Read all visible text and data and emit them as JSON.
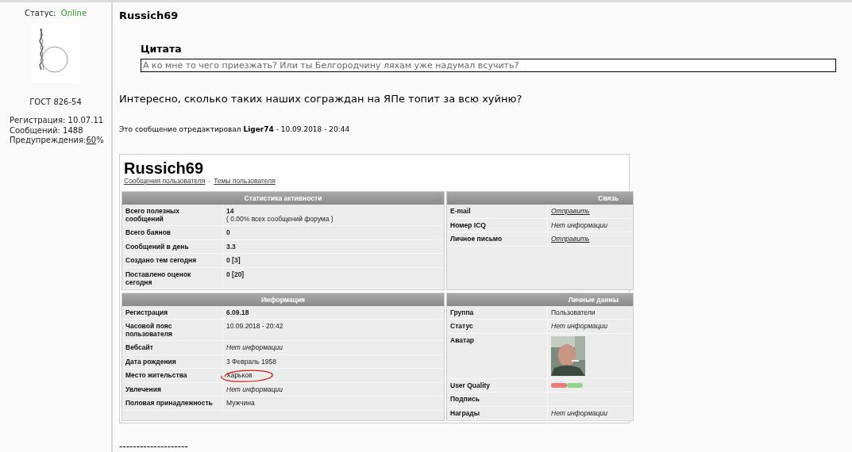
{
  "sidebar": {
    "status_label": "Статус:",
    "status_value": "Online",
    "online": true,
    "avatar_caption": "ГОСТ 826-54",
    "stats": [
      {
        "label": "Регистрация:",
        "value": "10.07.11"
      },
      {
        "label": "Сообщений:",
        "value": "1488"
      }
    ],
    "warnings": {
      "label": "Предупреждения:",
      "value": "60",
      "suffix": "%"
    }
  },
  "post": {
    "author": "Russich69",
    "quote": {
      "title": "Цитата",
      "text": "А ко мне то чего приезжать? Или ты Белгородчину ляхам уже надумал всучить?"
    },
    "body": "Интересно, сколько таких наших сограждан на ЯПе топит за всю хуйню?",
    "edit_note": "Это сообщение отредактировал **Liger74** - 10.09.2018 - 20:44",
    "signature": "--------------------"
  },
  "profile": {
    "name": "Russich69",
    "links": [
      "Сообщения пользователя",
      "Темы пользователя"
    ],
    "link_separator": "·",
    "panels": [
      {
        "title": "Статистика активности",
        "rows": [
          {
            "label": "Всего полезных сообщений",
            "value": "14",
            "sub": "( 0.00% всех сообщений форума )",
            "kind": "bold",
            "circled": false
          },
          {
            "label": "Всего баянов",
            "value": "0",
            "kind": "bold",
            "circled": false
          },
          {
            "label": "Сообщений в день",
            "value": "3.3",
            "kind": "bold",
            "circled": false
          },
          {
            "label": "Создано тем сегодня",
            "value": "0 [3]",
            "kind": "bold",
            "circled": false
          },
          {
            "label": "Поставлено оценок сегодня",
            "value": "0 [20]",
            "kind": "bold",
            "circled": false
          }
        ]
      },
      {
        "title": "Связь",
        "rows": [
          {
            "label": "E-mail",
            "value": "Отправить",
            "kind": "link",
            "circled": false
          },
          {
            "label": "Номер ICQ",
            "value": "Нет информации",
            "kind": "italic",
            "circled": false
          },
          {
            "label": "Личное письмо",
            "value": "Отправить",
            "kind": "link",
            "circled": false
          }
        ]
      },
      {
        "title": "Информация",
        "rows": [
          {
            "label": "Регистрация",
            "value": "6.09.18",
            "kind": "bold",
            "circled": false
          },
          {
            "label": "Часовой пояс пользователя",
            "value": "10.09.2018 - 20:42",
            "kind": "plain",
            "circled": false
          },
          {
            "label": "Вебсайт",
            "value": "Нет информации",
            "kind": "italic",
            "circled": false
          },
          {
            "label": "Дата рождения",
            "value": "3 Февраль 1958",
            "kind": "plain",
            "circled": false
          },
          {
            "label": "Место жительства",
            "value": "Харьков",
            "kind": "plain",
            "circled": true
          },
          {
            "label": "Увлечения",
            "value": "Нет информации",
            "kind": "italic",
            "circled": false
          },
          {
            "label": "Половая принадлежность",
            "value": "Мужчина",
            "kind": "plain",
            "circled": false
          }
        ]
      },
      {
        "title": "Личные данны",
        "rows": [
          {
            "label": "Группа",
            "value": "Пользователи",
            "kind": "plain",
            "circled": false
          },
          {
            "label": "Статус",
            "value": "Нет информации",
            "kind": "italic",
            "circled": false
          },
          {
            "label": "Аватар",
            "kind": "avatar",
            "circled": false
          },
          {
            "label": "User Quality",
            "kind": "quality",
            "circled": false
          },
          {
            "label": "Подпись",
            "kind": "empty",
            "circled": false
          },
          {
            "label": "Награды",
            "value": "Нет информации",
            "kind": "italic",
            "circled": false
          }
        ]
      }
    ]
  }
}
